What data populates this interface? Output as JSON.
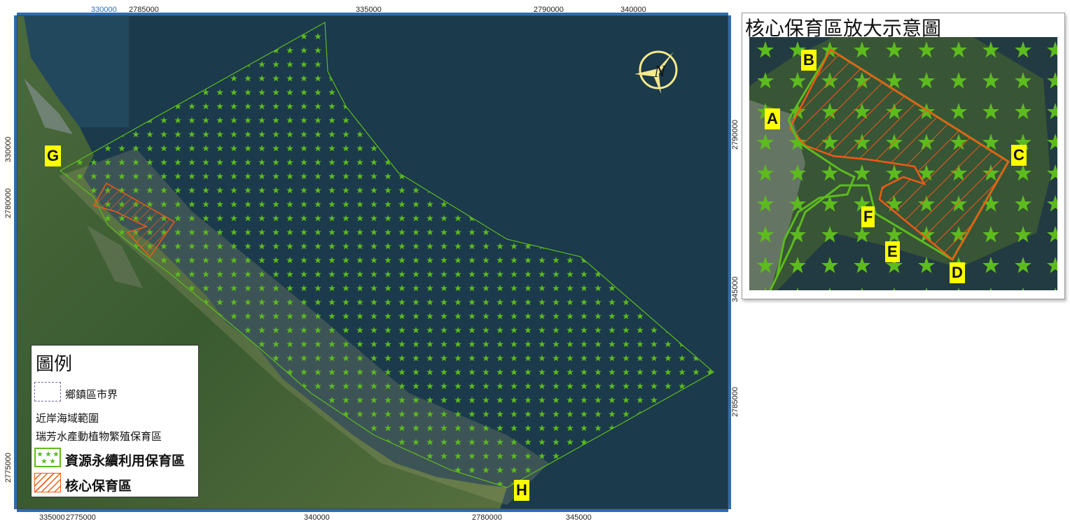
{
  "map": {
    "top_ticks": [
      {
        "text": "330000",
        "color": "#2b6cb0"
      },
      {
        "text": "2785000",
        "color": "#222"
      },
      {
        "text": "335000",
        "color": "#222"
      },
      {
        "text": "2790000",
        "color": "#222"
      },
      {
        "text": "340000",
        "color": "#222"
      }
    ],
    "bottom_ticks": [
      {
        "text": "335000",
        "color": "#222"
      },
      {
        "text": "2775000",
        "color": "#222"
      },
      {
        "text": "340000",
        "color": "#222"
      },
      {
        "text": "2780000",
        "color": "#222"
      },
      {
        "text": "345000",
        "color": "#222"
      }
    ],
    "left_ticks": [
      "330000",
      "2780000",
      "2775000"
    ],
    "right_ticks": [
      "2790000",
      "345000",
      "2785000"
    ],
    "point_labels": {
      "G": "G",
      "H": "H"
    },
    "north_arrow_label": "N"
  },
  "legend": {
    "title": "圖例",
    "boundary_label": "鄉鎮區市界",
    "nearshore_label": "近岸海域範圍",
    "reserve_label": "瑞芳水產動植物繁殖保育區",
    "sustainable_label": "資源永續利用保育區",
    "core_label": "核心保育區"
  },
  "inset": {
    "title": "核心保育區放大示意圖",
    "labels": {
      "A": "A",
      "B": "B",
      "C": "C",
      "D": "D",
      "E": "E",
      "F": "F"
    }
  },
  "colors": {
    "sea": "#1b3a4b",
    "zone_green": "#5dbb1e",
    "core_orange": "#f05a14",
    "label_yellow": "#ffff00"
  }
}
